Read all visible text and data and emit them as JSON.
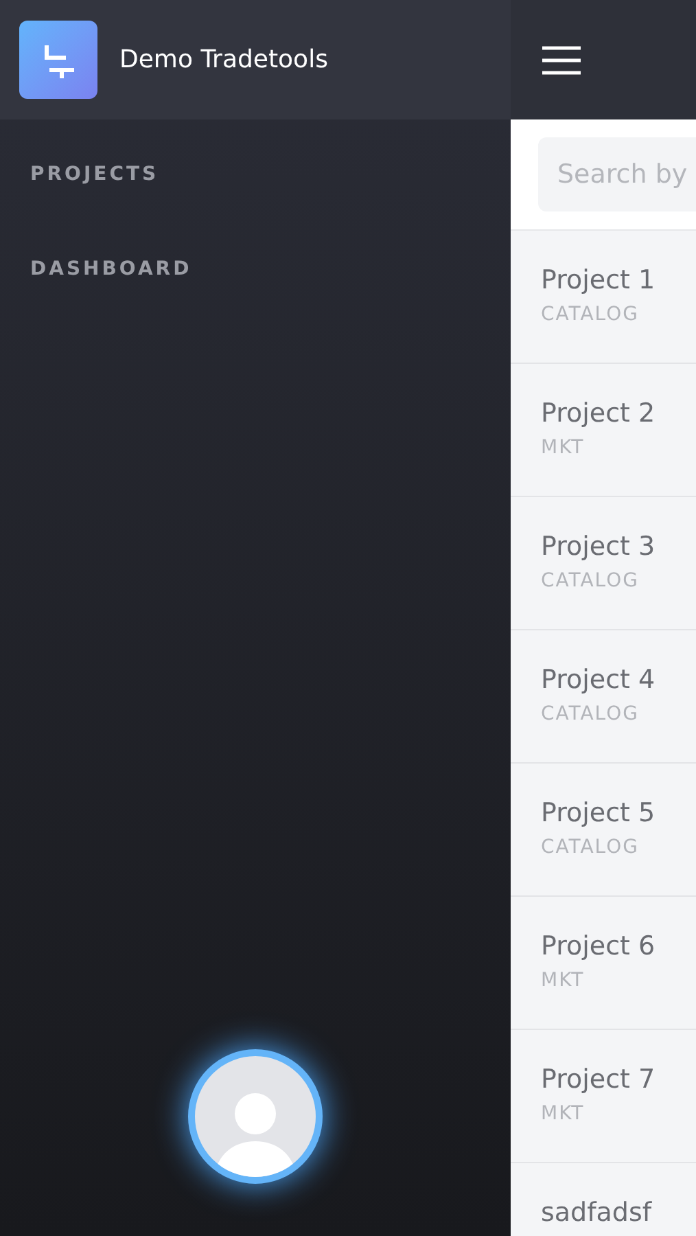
{
  "app": {
    "title": "Demo Tradetools"
  },
  "menu": [
    {
      "label": "PROJECTS"
    },
    {
      "label": "DASHBOARD"
    }
  ],
  "search": {
    "placeholder": "Search by"
  },
  "projects": [
    {
      "name": "Project 1",
      "type": "CATALOG"
    },
    {
      "name": "Project 2",
      "type": "MKT"
    },
    {
      "name": "Project 3",
      "type": "CATALOG"
    },
    {
      "name": "Project 4",
      "type": "CATALOG"
    },
    {
      "name": "Project 5",
      "type": "CATALOG"
    },
    {
      "name": "Project 6",
      "type": "MKT"
    },
    {
      "name": "Project 7",
      "type": "MKT"
    },
    {
      "name": "sadfadsf"
    }
  ]
}
